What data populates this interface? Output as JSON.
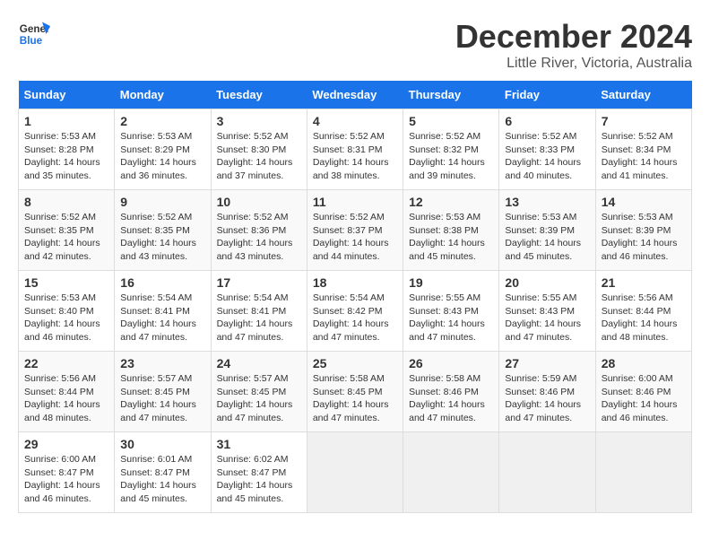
{
  "logo": {
    "line1": "General",
    "line2": "Blue"
  },
  "title": "December 2024",
  "location": "Little River, Victoria, Australia",
  "days_of_week": [
    "Sunday",
    "Monday",
    "Tuesday",
    "Wednesday",
    "Thursday",
    "Friday",
    "Saturday"
  ],
  "weeks": [
    [
      {
        "day": "1",
        "sunrise": "5:53 AM",
        "sunset": "8:28 PM",
        "daylight": "14 hours and 35 minutes."
      },
      {
        "day": "2",
        "sunrise": "5:53 AM",
        "sunset": "8:29 PM",
        "daylight": "14 hours and 36 minutes."
      },
      {
        "day": "3",
        "sunrise": "5:52 AM",
        "sunset": "8:30 PM",
        "daylight": "14 hours and 37 minutes."
      },
      {
        "day": "4",
        "sunrise": "5:52 AM",
        "sunset": "8:31 PM",
        "daylight": "14 hours and 38 minutes."
      },
      {
        "day": "5",
        "sunrise": "5:52 AM",
        "sunset": "8:32 PM",
        "daylight": "14 hours and 39 minutes."
      },
      {
        "day": "6",
        "sunrise": "5:52 AM",
        "sunset": "8:33 PM",
        "daylight": "14 hours and 40 minutes."
      },
      {
        "day": "7",
        "sunrise": "5:52 AM",
        "sunset": "8:34 PM",
        "daylight": "14 hours and 41 minutes."
      }
    ],
    [
      {
        "day": "8",
        "sunrise": "5:52 AM",
        "sunset": "8:35 PM",
        "daylight": "14 hours and 42 minutes."
      },
      {
        "day": "9",
        "sunrise": "5:52 AM",
        "sunset": "8:35 PM",
        "daylight": "14 hours and 43 minutes."
      },
      {
        "day": "10",
        "sunrise": "5:52 AM",
        "sunset": "8:36 PM",
        "daylight": "14 hours and 43 minutes."
      },
      {
        "day": "11",
        "sunrise": "5:52 AM",
        "sunset": "8:37 PM",
        "daylight": "14 hours and 44 minutes."
      },
      {
        "day": "12",
        "sunrise": "5:53 AM",
        "sunset": "8:38 PM",
        "daylight": "14 hours and 45 minutes."
      },
      {
        "day": "13",
        "sunrise": "5:53 AM",
        "sunset": "8:39 PM",
        "daylight": "14 hours and 45 minutes."
      },
      {
        "day": "14",
        "sunrise": "5:53 AM",
        "sunset": "8:39 PM",
        "daylight": "14 hours and 46 minutes."
      }
    ],
    [
      {
        "day": "15",
        "sunrise": "5:53 AM",
        "sunset": "8:40 PM",
        "daylight": "14 hours and 46 minutes."
      },
      {
        "day": "16",
        "sunrise": "5:54 AM",
        "sunset": "8:41 PM",
        "daylight": "14 hours and 47 minutes."
      },
      {
        "day": "17",
        "sunrise": "5:54 AM",
        "sunset": "8:41 PM",
        "daylight": "14 hours and 47 minutes."
      },
      {
        "day": "18",
        "sunrise": "5:54 AM",
        "sunset": "8:42 PM",
        "daylight": "14 hours and 47 minutes."
      },
      {
        "day": "19",
        "sunrise": "5:55 AM",
        "sunset": "8:43 PM",
        "daylight": "14 hours and 47 minutes."
      },
      {
        "day": "20",
        "sunrise": "5:55 AM",
        "sunset": "8:43 PM",
        "daylight": "14 hours and 47 minutes."
      },
      {
        "day": "21",
        "sunrise": "5:56 AM",
        "sunset": "8:44 PM",
        "daylight": "14 hours and 48 minutes."
      }
    ],
    [
      {
        "day": "22",
        "sunrise": "5:56 AM",
        "sunset": "8:44 PM",
        "daylight": "14 hours and 48 minutes."
      },
      {
        "day": "23",
        "sunrise": "5:57 AM",
        "sunset": "8:45 PM",
        "daylight": "14 hours and 47 minutes."
      },
      {
        "day": "24",
        "sunrise": "5:57 AM",
        "sunset": "8:45 PM",
        "daylight": "14 hours and 47 minutes."
      },
      {
        "day": "25",
        "sunrise": "5:58 AM",
        "sunset": "8:45 PM",
        "daylight": "14 hours and 47 minutes."
      },
      {
        "day": "26",
        "sunrise": "5:58 AM",
        "sunset": "8:46 PM",
        "daylight": "14 hours and 47 minutes."
      },
      {
        "day": "27",
        "sunrise": "5:59 AM",
        "sunset": "8:46 PM",
        "daylight": "14 hours and 47 minutes."
      },
      {
        "day": "28",
        "sunrise": "6:00 AM",
        "sunset": "8:46 PM",
        "daylight": "14 hours and 46 minutes."
      }
    ],
    [
      {
        "day": "29",
        "sunrise": "6:00 AM",
        "sunset": "8:47 PM",
        "daylight": "14 hours and 46 minutes."
      },
      {
        "day": "30",
        "sunrise": "6:01 AM",
        "sunset": "8:47 PM",
        "daylight": "14 hours and 45 minutes."
      },
      {
        "day": "31",
        "sunrise": "6:02 AM",
        "sunset": "8:47 PM",
        "daylight": "14 hours and 45 minutes."
      },
      null,
      null,
      null,
      null
    ]
  ]
}
